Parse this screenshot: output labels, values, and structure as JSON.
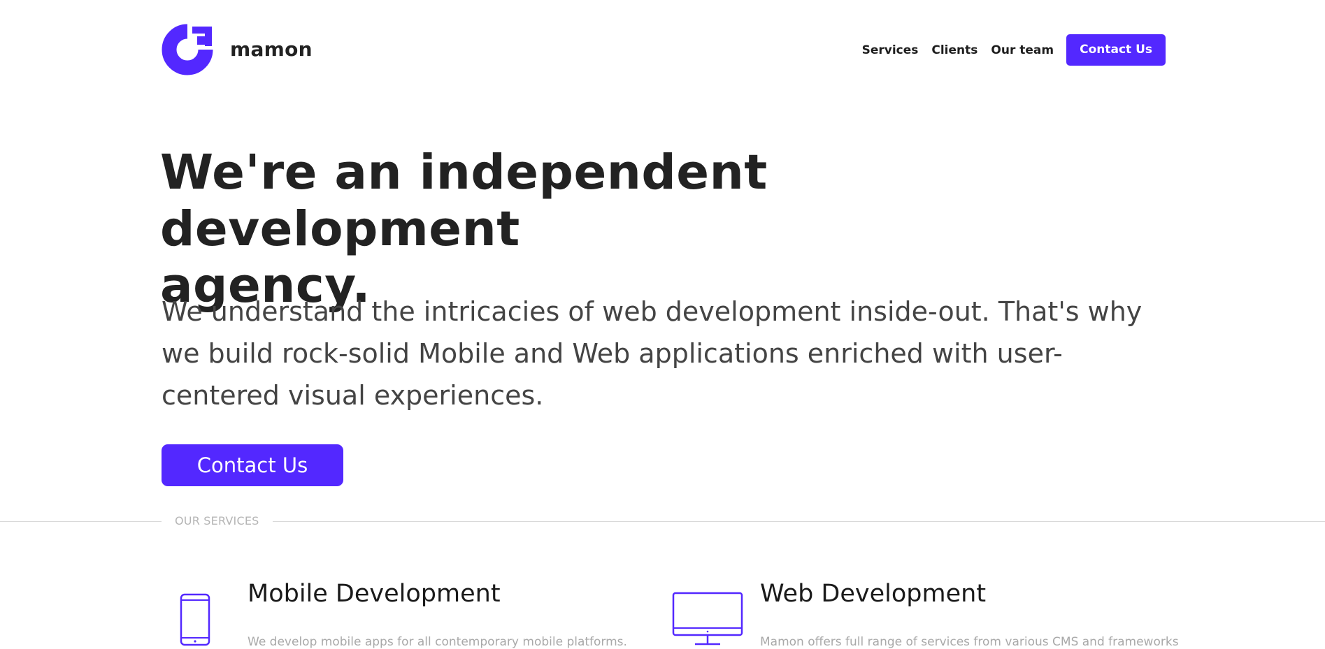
{
  "colors": {
    "accent": "#5328ff",
    "text_dark": "#222222",
    "text_body": "#444444",
    "muted": "#a9a9a9"
  },
  "header": {
    "brand": "mamon",
    "logo_icon": "mamon-logo-icon",
    "nav": {
      "services": "Services",
      "clients": "Clients",
      "our_team": "Our team",
      "contact": "Contact Us"
    }
  },
  "hero": {
    "title_line1": "We're an independent development",
    "title_line2": "agency.",
    "text": "We understand the intricacies of web development inside-out. That's why we build rock-solid Mobile and Web applications enriched with user-centered visual experiences.",
    "cta": "Contact Us"
  },
  "services_section": {
    "label": "OUR SERVICES",
    "items": [
      {
        "icon": "mobile-phone-icon",
        "title": "Mobile Development",
        "description": "We develop mobile apps for all contemporary mobile platforms."
      },
      {
        "icon": "desktop-monitor-icon",
        "title": "Web Development",
        "description": "Mamon offers full range of services from various CMS and frameworks"
      }
    ]
  }
}
